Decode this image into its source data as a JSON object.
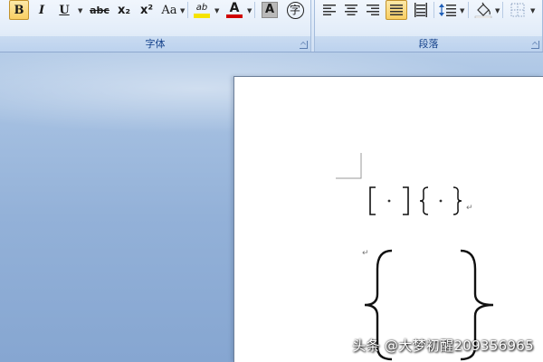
{
  "ribbon": {
    "font_group": {
      "label": "字体",
      "bold": "B",
      "italic": "I",
      "underline": "U",
      "strikethrough": "abc",
      "subscript": "x₂",
      "superscript": "x²",
      "change_case": "Aa",
      "highlight": "ab",
      "font_color": "A",
      "char_shading": "A",
      "enclose_char": "字"
    },
    "paragraph_group": {
      "label": "段落"
    }
  },
  "colors": {
    "highlight_yellow": "#f5e300",
    "font_color_red": "#d00000",
    "accent_blue": "#15428b"
  },
  "watermark": "头条 @大梦初醒209356965"
}
